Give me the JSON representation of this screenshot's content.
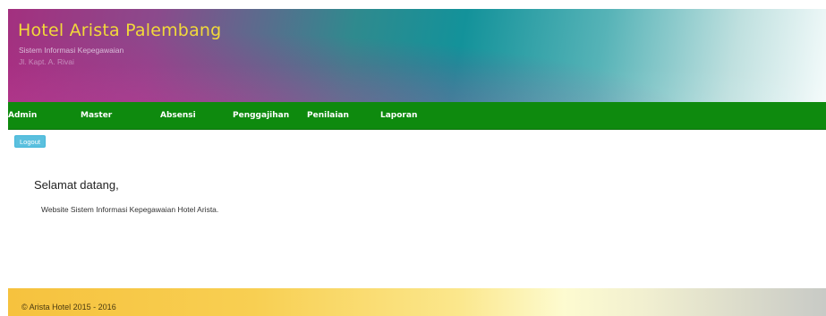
{
  "header": {
    "title": "Hotel Arista Palembang",
    "subtitle": "Sistem Informasi Kepegawaian",
    "address": "Jl. Kapt. A. Rivai"
  },
  "nav": {
    "items": [
      {
        "label": "Admin"
      },
      {
        "label": "Master"
      },
      {
        "label": "Absensi"
      },
      {
        "label": "Penggajihan"
      },
      {
        "label": "Penilaian"
      },
      {
        "label": "Laporan"
      }
    ],
    "color": "#0e8a0e"
  },
  "logout": {
    "label": "Logout",
    "color": "#5bc0de"
  },
  "main": {
    "welcome": "Selamat datang,",
    "description": "Website Sistem Informasi Kepegawaian Hotel Arista."
  },
  "footer": {
    "text": "© Arista Hotel 2015 - 2016"
  }
}
